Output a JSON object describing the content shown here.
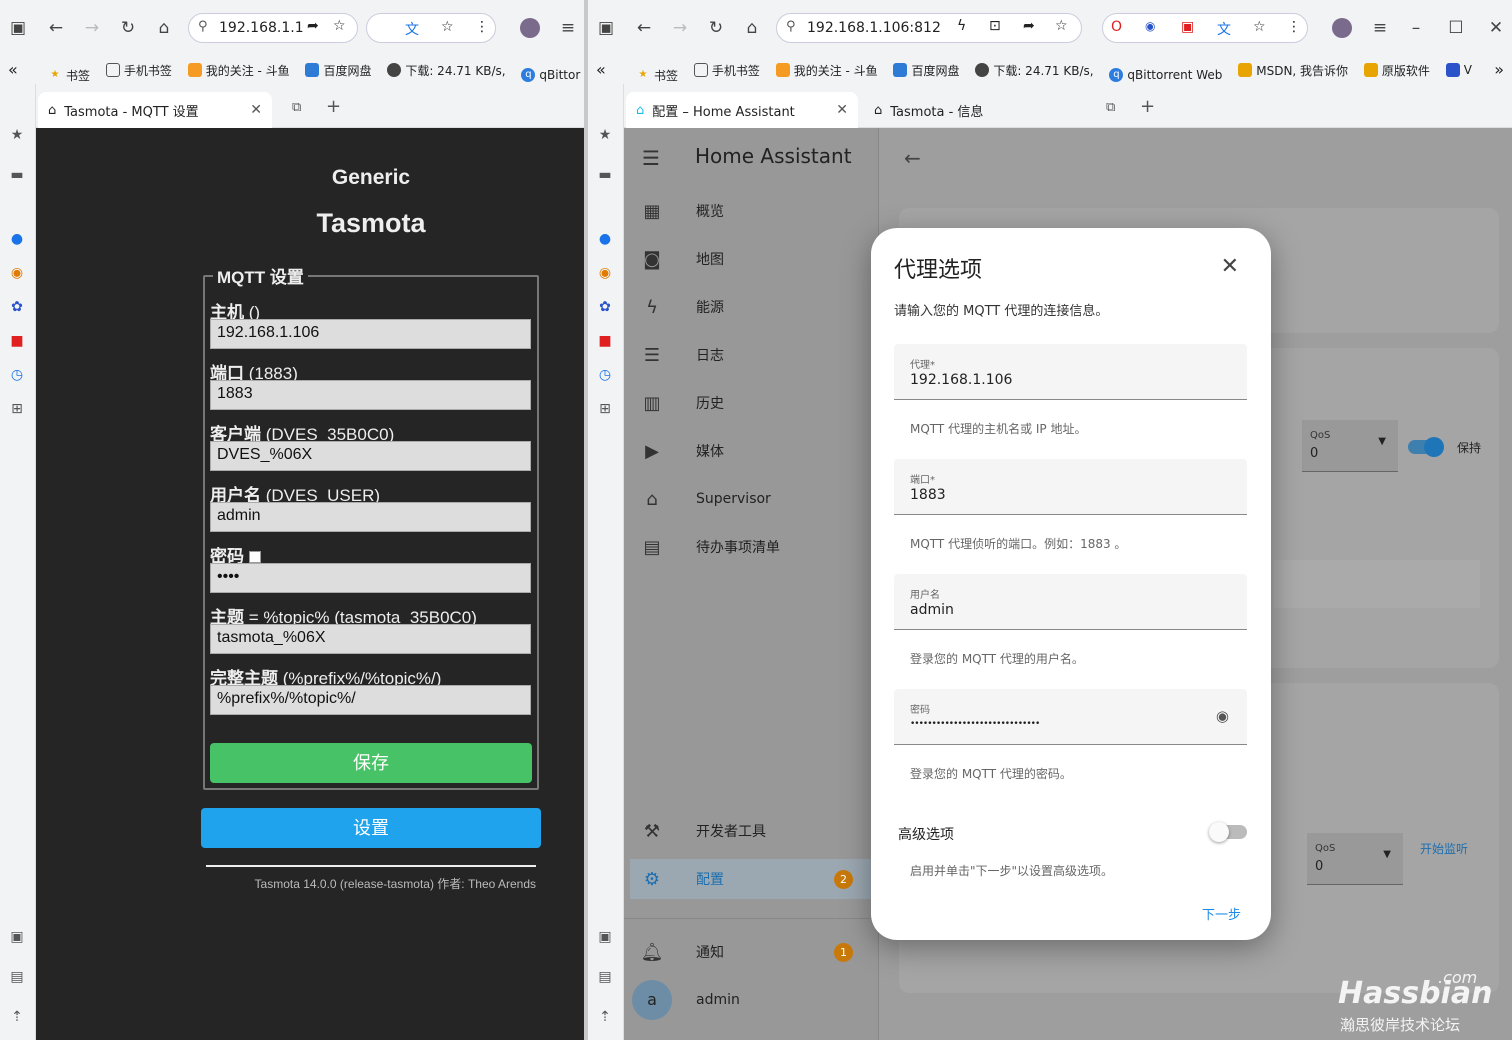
{
  "left": {
    "url": "192.168.1.1",
    "bookmarks": [
      "书签",
      "手机书签",
      "我的关注 - 斗鱼",
      "百度网盘",
      "下载: 24.71 KB/s,",
      "qBittor"
    ],
    "tab": {
      "title": "Tasmota - MQTT 设置"
    },
    "tasmota": {
      "title1": "Generic",
      "title2": "Tasmota",
      "legend": "MQTT 设置",
      "fields": [
        {
          "label": "主机",
          "hint": " ()",
          "value": "192.168.1.106"
        },
        {
          "label": "端口",
          "hint": " (1883)",
          "value": "1883"
        },
        {
          "label": "客户端",
          "hint": " (DVES_35B0C0)",
          "value": "DVES_%06X"
        },
        {
          "label": "用户名",
          "hint": " (DVES_USER)",
          "value": "admin"
        },
        {
          "label": "密码",
          "hint": "",
          "value": "••••"
        },
        {
          "label": "主题",
          "hint": " = %topic% (tasmota_35B0C0)",
          "value": "tasmota_%06X"
        },
        {
          "label": "完整主题",
          "hint": " (%prefix%/%topic%/)",
          "value": "%prefix%/%topic%/"
        }
      ],
      "save": "保存",
      "settings": "设置",
      "footer": "Tasmota 14.0.0 (release-tasmota) 作者: Theo Arends"
    }
  },
  "right": {
    "url": "192.168.1.106:812",
    "bookmarks": [
      "书签",
      "手机书签",
      "我的关注 - 斗鱼",
      "百度网盘",
      "下载: 24.71 KB/s,",
      "qBittorrent Web",
      "MSDN, 我告诉你",
      "原版软件",
      "V"
    ],
    "tabs": [
      {
        "title": "配置 – Home Assistant"
      },
      {
        "title": "Tasmota - 信息"
      }
    ],
    "ha": {
      "app_title": "Home Assistant",
      "nav": [
        "概览",
        "地图",
        "能源",
        "日志",
        "历史",
        "媒体",
        "Supervisor",
        "待办事项清单"
      ],
      "dev_tools": "开发者工具",
      "config": "配置",
      "config_badge": "2",
      "notifications": "通知",
      "notif_badge": "1",
      "user": "admin",
      "avatar": "a",
      "bg": {
        "qos_label": "QoS",
        "qos_value": "0",
        "retain": "保持",
        "listen": "开始监听"
      }
    },
    "dialog": {
      "title": "代理选项",
      "desc": "请输入您的 MQTT 代理的连接信息。",
      "broker_label": "代理*",
      "broker_value": "192.168.1.106",
      "broker_help": "MQTT 代理的主机名或 IP 地址。",
      "port_label": "端口*",
      "port_value": "1883",
      "port_help": "MQTT 代理侦听的端口。例如：1883 。",
      "user_label": "用户名",
      "user_value": "admin",
      "user_help": "登录您的 MQTT 代理的用户名。",
      "pass_label": "密码",
      "pass_value": "••••••••••••••••••••••••••••••",
      "pass_help": "登录您的 MQTT 代理的密码。",
      "advanced": "高级选项",
      "advanced_help": "启用并单击\"下一步\"以设置高级选项。",
      "next": "下一步"
    }
  },
  "watermark": {
    "brand": "Hassbian",
    "tld": ".com",
    "sub": "瀚思彼岸技术论坛"
  }
}
